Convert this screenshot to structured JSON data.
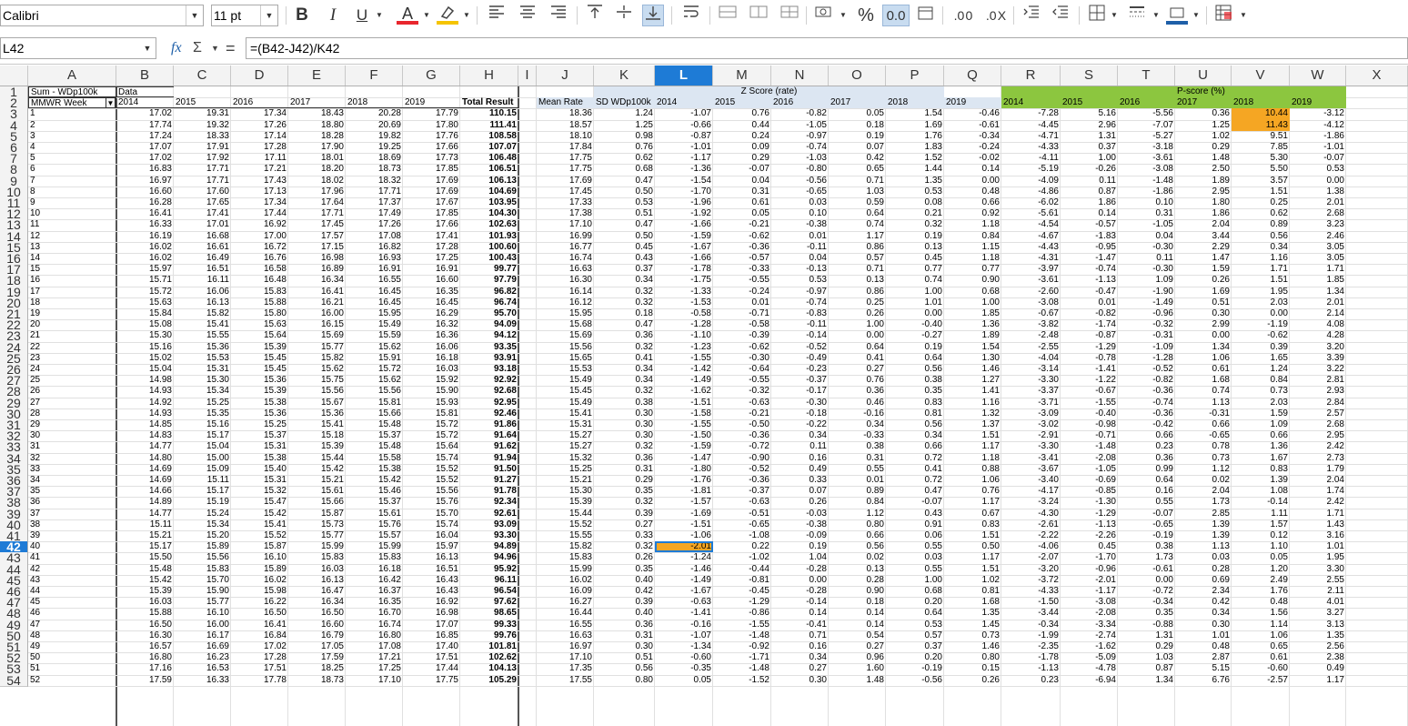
{
  "toolbar": {
    "font_name": "Calibri",
    "font_size": "11 pt",
    "icons": [
      "bold-icon",
      "italic-icon",
      "underline-icon",
      "font-color-icon",
      "highlight-icon",
      "align-left-icon",
      "align-center-icon",
      "align-right-icon",
      "align-top-icon",
      "align-middle-icon",
      "align-bottom-icon",
      "wrap-text-icon",
      "merge-icon",
      "merge-across-icon",
      "unmerge-icon",
      "currency-icon",
      "percent-icon",
      "number-format-icon",
      "date-format-icon",
      "add-decimal-icon",
      "delete-decimal-icon",
      "increase-indent-icon",
      "decrease-indent-icon",
      "borders-icon",
      "border-style-icon",
      "border-color-icon",
      "conditional-format-icon"
    ],
    "glyphs": {
      "bold": "B",
      "italic": "I",
      "underline": "U",
      "font_color": "A",
      "percent": "%",
      "number": "0.0",
      "add_dec": ".0 0",
      "del_dec": ".0 X"
    }
  },
  "formula_bar": {
    "name_box": "L42",
    "fx": "fx",
    "sum": "Σ",
    "equals": "=",
    "formula": "=(B42-J42)/K42"
  },
  "columns": [
    "A",
    "B",
    "C",
    "D",
    "E",
    "F",
    "G",
    "H",
    "I",
    "J",
    "K",
    "L",
    "M",
    "N",
    "O",
    "P",
    "Q",
    "R",
    "S",
    "T",
    "U",
    "V",
    "W",
    "X"
  ],
  "active_column": "L",
  "active_row": 42,
  "headers": {
    "a1": "Sum - WDp100k",
    "b1": "Data",
    "a2": "MMWR Week",
    "years_bg": [
      "2014",
      "2015",
      "2016",
      "2017",
      "2018",
      "2019"
    ],
    "h2": "Total Result",
    "j2": "Mean Rate",
    "k2": "SD WDp100k",
    "z_title": "Z Score (rate)",
    "z_years": [
      "2014",
      "2015",
      "2016",
      "2017",
      "2018",
      "2019"
    ],
    "p_title": "P-score (%)",
    "p_years": [
      "2014",
      "2015",
      "2016",
      "2017",
      "2018",
      "2019"
    ]
  },
  "colors": {
    "active": "#1e7bd6",
    "green": "#8cc63f",
    "zheader": "#dce6f2",
    "highlight": "#f5a623"
  },
  "rows": [
    [
      "1",
      "17.02",
      "19.31",
      "17.34",
      "18.43",
      "20.28",
      "17.79",
      "110.15",
      "18.36",
      "1.24",
      "-1.07",
      "0.76",
      "-0.82",
      "0.05",
      "1.54",
      "-0.46",
      "-7.28",
      "5.16",
      "-5.56",
      "0.36",
      "10.44",
      "-3.12"
    ],
    [
      "2",
      "17.74",
      "19.32",
      "17.26",
      "18.80",
      "20.69",
      "17.80",
      "111.41",
      "18.57",
      "1.25",
      "-0.66",
      "0.44",
      "-1.05",
      "0.18",
      "1.69",
      "-0.61",
      "-4.45",
      "2.96",
      "-7.07",
      "1.25",
      "11.43",
      "-4.12"
    ],
    [
      "3",
      "17.24",
      "18.33",
      "17.14",
      "18.28",
      "19.82",
      "17.76",
      "108.58",
      "18.10",
      "0.98",
      "-0.87",
      "0.24",
      "-0.97",
      "0.19",
      "1.76",
      "-0.34",
      "-4.71",
      "1.31",
      "-5.27",
      "1.02",
      "9.51",
      "-1.86"
    ],
    [
      "4",
      "17.07",
      "17.91",
      "17.28",
      "17.90",
      "19.25",
      "17.66",
      "107.07",
      "17.84",
      "0.76",
      "-1.01",
      "0.09",
      "-0.74",
      "0.07",
      "1.83",
      "-0.24",
      "-4.33",
      "0.37",
      "-3.18",
      "0.29",
      "7.85",
      "-1.01"
    ],
    [
      "5",
      "17.02",
      "17.92",
      "17.11",
      "18.01",
      "18.69",
      "17.73",
      "106.48",
      "17.75",
      "0.62",
      "-1.17",
      "0.29",
      "-1.03",
      "0.42",
      "1.52",
      "-0.02",
      "-4.11",
      "1.00",
      "-3.61",
      "1.48",
      "5.30",
      "-0.07"
    ],
    [
      "6",
      "16.83",
      "17.71",
      "17.21",
      "18.20",
      "18.73",
      "17.85",
      "106.51",
      "17.75",
      "0.68",
      "-1.36",
      "-0.07",
      "-0.80",
      "0.65",
      "1.44",
      "0.14",
      "-5.19",
      "-0.26",
      "-3.08",
      "2.50",
      "5.50",
      "0.53"
    ],
    [
      "7",
      "16.97",
      "17.71",
      "17.43",
      "18.02",
      "18.32",
      "17.69",
      "106.13",
      "17.69",
      "0.47",
      "-1.54",
      "0.04",
      "-0.56",
      "0.71",
      "1.35",
      "0.00",
      "-4.09",
      "0.11",
      "-1.48",
      "1.89",
      "3.57",
      "0.00"
    ],
    [
      "8",
      "16.60",
      "17.60",
      "17.13",
      "17.96",
      "17.71",
      "17.69",
      "104.69",
      "17.45",
      "0.50",
      "-1.70",
      "0.31",
      "-0.65",
      "1.03",
      "0.53",
      "0.48",
      "-4.86",
      "0.87",
      "-1.86",
      "2.95",
      "1.51",
      "1.38"
    ],
    [
      "9",
      "16.28",
      "17.65",
      "17.34",
      "17.64",
      "17.37",
      "17.67",
      "103.95",
      "17.33",
      "0.53",
      "-1.96",
      "0.61",
      "0.03",
      "0.59",
      "0.08",
      "0.66",
      "-6.02",
      "1.86",
      "0.10",
      "1.80",
      "0.25",
      "2.01"
    ],
    [
      "10",
      "16.41",
      "17.41",
      "17.44",
      "17.71",
      "17.49",
      "17.85",
      "104.30",
      "17.38",
      "0.51",
      "-1.92",
      "0.05",
      "0.10",
      "0.64",
      "0.21",
      "0.92",
      "-5.61",
      "0.14",
      "0.31",
      "1.86",
      "0.62",
      "2.68"
    ],
    [
      "11",
      "16.33",
      "17.01",
      "16.92",
      "17.45",
      "17.26",
      "17.66",
      "102.63",
      "17.10",
      "0.47",
      "-1.66",
      "-0.21",
      "-0.38",
      "0.74",
      "0.32",
      "1.18",
      "-4.54",
      "-0.57",
      "-1.05",
      "2.04",
      "0.89",
      "3.23"
    ],
    [
      "12",
      "16.19",
      "16.68",
      "17.00",
      "17.57",
      "17.08",
      "17.41",
      "101.93",
      "16.99",
      "0.50",
      "-1.59",
      "-0.62",
      "0.01",
      "1.17",
      "0.19",
      "0.84",
      "-4.67",
      "-1.83",
      "0.04",
      "3.44",
      "0.56",
      "2.46"
    ],
    [
      "13",
      "16.02",
      "16.61",
      "16.72",
      "17.15",
      "16.82",
      "17.28",
      "100.60",
      "16.77",
      "0.45",
      "-1.67",
      "-0.36",
      "-0.11",
      "0.86",
      "0.13",
      "1.15",
      "-4.43",
      "-0.95",
      "-0.30",
      "2.29",
      "0.34",
      "3.05"
    ],
    [
      "14",
      "16.02",
      "16.49",
      "16.76",
      "16.98",
      "16.93",
      "17.25",
      "100.43",
      "16.74",
      "0.43",
      "-1.66",
      "-0.57",
      "0.04",
      "0.57",
      "0.45",
      "1.18",
      "-4.31",
      "-1.47",
      "0.11",
      "1.47",
      "1.16",
      "3.05"
    ],
    [
      "15",
      "15.97",
      "16.51",
      "16.58",
      "16.89",
      "16.91",
      "16.91",
      "99.77",
      "16.63",
      "0.37",
      "-1.78",
      "-0.33",
      "-0.13",
      "0.71",
      "0.77",
      "0.77",
      "-3.97",
      "-0.74",
      "-0.30",
      "1.59",
      "1.71",
      "1.71"
    ],
    [
      "16",
      "15.71",
      "16.11",
      "16.48",
      "16.34",
      "16.55",
      "16.60",
      "97.79",
      "16.30",
      "0.34",
      "-1.75",
      "-0.55",
      "0.53",
      "0.13",
      "0.74",
      "0.90",
      "-3.61",
      "-1.13",
      "1.09",
      "0.26",
      "1.51",
      "1.85"
    ],
    [
      "17",
      "15.72",
      "16.06",
      "15.83",
      "16.41",
      "16.45",
      "16.35",
      "96.82",
      "16.14",
      "0.32",
      "-1.33",
      "-0.24",
      "-0.97",
      "0.86",
      "1.00",
      "0.68",
      "-2.60",
      "-0.47",
      "-1.90",
      "1.69",
      "1.95",
      "1.34"
    ],
    [
      "18",
      "15.63",
      "16.13",
      "15.88",
      "16.21",
      "16.45",
      "16.45",
      "96.74",
      "16.12",
      "0.32",
      "-1.53",
      "0.01",
      "-0.74",
      "0.25",
      "1.01",
      "1.00",
      "-3.08",
      "0.01",
      "-1.49",
      "0.51",
      "2.03",
      "2.01"
    ],
    [
      "19",
      "15.84",
      "15.82",
      "15.80",
      "16.00",
      "15.95",
      "16.29",
      "95.70",
      "15.95",
      "0.18",
      "-0.58",
      "-0.71",
      "-0.83",
      "0.26",
      "0.00",
      "1.85",
      "-0.67",
      "-0.82",
      "-0.96",
      "0.30",
      "0.00",
      "2.14"
    ],
    [
      "20",
      "15.08",
      "15.41",
      "15.63",
      "16.15",
      "15.49",
      "16.32",
      "94.09",
      "15.68",
      "0.47",
      "-1.28",
      "-0.58",
      "-0.11",
      "1.00",
      "-0.40",
      "1.36",
      "-3.82",
      "-1.74",
      "-0.32",
      "2.99",
      "-1.19",
      "4.08"
    ],
    [
      "21",
      "15.30",
      "15.55",
      "15.64",
      "15.69",
      "15.59",
      "16.36",
      "94.12",
      "15.69",
      "0.36",
      "-1.10",
      "-0.39",
      "-0.14",
      "0.00",
      "-0.27",
      "1.89",
      "-2.48",
      "-0.87",
      "-0.31",
      "0.00",
      "-0.62",
      "4.28"
    ],
    [
      "22",
      "15.16",
      "15.36",
      "15.39",
      "15.77",
      "15.62",
      "16.06",
      "93.35",
      "15.56",
      "0.32",
      "-1.23",
      "-0.62",
      "-0.52",
      "0.64",
      "0.19",
      "1.54",
      "-2.55",
      "-1.29",
      "-1.09",
      "1.34",
      "0.39",
      "3.20"
    ],
    [
      "23",
      "15.02",
      "15.53",
      "15.45",
      "15.82",
      "15.91",
      "16.18",
      "93.91",
      "15.65",
      "0.41",
      "-1.55",
      "-0.30",
      "-0.49",
      "0.41",
      "0.64",
      "1.30",
      "-4.04",
      "-0.78",
      "-1.28",
      "1.06",
      "1.65",
      "3.39"
    ],
    [
      "24",
      "15.04",
      "15.31",
      "15.45",
      "15.62",
      "15.72",
      "16.03",
      "93.18",
      "15.53",
      "0.34",
      "-1.42",
      "-0.64",
      "-0.23",
      "0.27",
      "0.56",
      "1.46",
      "-3.14",
      "-1.41",
      "-0.52",
      "0.61",
      "1.24",
      "3.22"
    ],
    [
      "25",
      "14.98",
      "15.30",
      "15.36",
      "15.75",
      "15.62",
      "15.92",
      "92.92",
      "15.49",
      "0.34",
      "-1.49",
      "-0.55",
      "-0.37",
      "0.76",
      "0.38",
      "1.27",
      "-3.30",
      "-1.22",
      "-0.82",
      "1.68",
      "0.84",
      "2.81"
    ],
    [
      "26",
      "14.93",
      "15.34",
      "15.39",
      "15.56",
      "15.56",
      "15.90",
      "92.68",
      "15.45",
      "0.32",
      "-1.62",
      "-0.32",
      "-0.17",
      "0.36",
      "0.35",
      "1.41",
      "-3.37",
      "-0.67",
      "-0.36",
      "0.74",
      "0.73",
      "2.93"
    ],
    [
      "27",
      "14.92",
      "15.25",
      "15.38",
      "15.67",
      "15.81",
      "15.93",
      "92.95",
      "15.49",
      "0.38",
      "-1.51",
      "-0.63",
      "-0.30",
      "0.46",
      "0.83",
      "1.16",
      "-3.71",
      "-1.55",
      "-0.74",
      "1.13",
      "2.03",
      "2.84"
    ],
    [
      "28",
      "14.93",
      "15.35",
      "15.36",
      "15.36",
      "15.66",
      "15.81",
      "92.46",
      "15.41",
      "0.30",
      "-1.58",
      "-0.21",
      "-0.18",
      "-0.16",
      "0.81",
      "1.32",
      "-3.09",
      "-0.40",
      "-0.36",
      "-0.31",
      "1.59",
      "2.57"
    ],
    [
      "29",
      "14.85",
      "15.16",
      "15.25",
      "15.41",
      "15.48",
      "15.72",
      "91.86",
      "15.31",
      "0.30",
      "-1.55",
      "-0.50",
      "-0.22",
      "0.34",
      "0.56",
      "1.37",
      "-3.02",
      "-0.98",
      "-0.42",
      "0.66",
      "1.09",
      "2.68"
    ],
    [
      "30",
      "14.83",
      "15.17",
      "15.37",
      "15.18",
      "15.37",
      "15.72",
      "91.64",
      "15.27",
      "0.30",
      "-1.50",
      "-0.36",
      "0.34",
      "-0.33",
      "0.34",
      "1.51",
      "-2.91",
      "-0.71",
      "0.66",
      "-0.65",
      "0.66",
      "2.95"
    ],
    [
      "31",
      "14.77",
      "15.04",
      "15.31",
      "15.39",
      "15.48",
      "15.64",
      "91.62",
      "15.27",
      "0.32",
      "-1.59",
      "-0.72",
      "0.11",
      "0.38",
      "0.66",
      "1.17",
      "-3.30",
      "-1.48",
      "0.23",
      "0.78",
      "1.36",
      "2.42"
    ],
    [
      "32",
      "14.80",
      "15.00",
      "15.38",
      "15.44",
      "15.58",
      "15.74",
      "91.94",
      "15.32",
      "0.36",
      "-1.47",
      "-0.90",
      "0.16",
      "0.31",
      "0.72",
      "1.18",
      "-3.41",
      "-2.08",
      "0.36",
      "0.73",
      "1.67",
      "2.73"
    ],
    [
      "33",
      "14.69",
      "15.09",
      "15.40",
      "15.42",
      "15.38",
      "15.52",
      "91.50",
      "15.25",
      "0.31",
      "-1.80",
      "-0.52",
      "0.49",
      "0.55",
      "0.41",
      "0.88",
      "-3.67",
      "-1.05",
      "0.99",
      "1.12",
      "0.83",
      "1.79"
    ],
    [
      "34",
      "14.69",
      "15.11",
      "15.31",
      "15.21",
      "15.42",
      "15.52",
      "91.27",
      "15.21",
      "0.29",
      "-1.76",
      "-0.36",
      "0.33",
      "0.01",
      "0.72",
      "1.06",
      "-3.40",
      "-0.69",
      "0.64",
      "0.02",
      "1.39",
      "2.04"
    ],
    [
      "35",
      "14.66",
      "15.17",
      "15.32",
      "15.61",
      "15.46",
      "15.56",
      "91.78",
      "15.30",
      "0.35",
      "-1.81",
      "-0.37",
      "0.07",
      "0.89",
      "0.47",
      "0.76",
      "-4.17",
      "-0.85",
      "0.16",
      "2.04",
      "1.08",
      "1.74"
    ],
    [
      "36",
      "14.89",
      "15.19",
      "15.47",
      "15.66",
      "15.37",
      "15.76",
      "92.34",
      "15.39",
      "0.32",
      "-1.57",
      "-0.63",
      "0.26",
      "0.84",
      "-0.07",
      "1.17",
      "-3.24",
      "-1.30",
      "0.55",
      "1.73",
      "-0.14",
      "2.42"
    ],
    [
      "37",
      "14.77",
      "15.24",
      "15.42",
      "15.87",
      "15.61",
      "15.70",
      "92.61",
      "15.44",
      "0.39",
      "-1.69",
      "-0.51",
      "-0.03",
      "1.12",
      "0.43",
      "0.67",
      "-4.30",
      "-1.29",
      "-0.07",
      "2.85",
      "1.11",
      "1.71"
    ],
    [
      "38",
      "15.11",
      "15.34",
      "15.41",
      "15.73",
      "15.76",
      "15.74",
      "93.09",
      "15.52",
      "0.27",
      "-1.51",
      "-0.65",
      "-0.38",
      "0.80",
      "0.91",
      "0.83",
      "-2.61",
      "-1.13",
      "-0.65",
      "1.39",
      "1.57",
      "1.43"
    ],
    [
      "39",
      "15.21",
      "15.20",
      "15.52",
      "15.77",
      "15.57",
      "16.04",
      "93.30",
      "15.55",
      "0.33",
      "-1.06",
      "-1.08",
      "-0.09",
      "0.66",
      "0.06",
      "1.51",
      "-2.22",
      "-2.26",
      "-0.19",
      "1.39",
      "0.12",
      "3.16"
    ],
    [
      "40",
      "15.17",
      "15.89",
      "15.87",
      "15.99",
      "15.99",
      "15.97",
      "94.89",
      "15.82",
      "0.32",
      "-2.01",
      "0.22",
      "0.19",
      "0.56",
      "0.55",
      "0.50",
      "-4.06",
      "0.45",
      "0.38",
      "1.13",
      "1.10",
      "1.01"
    ],
    [
      "41",
      "15.50",
      "15.56",
      "16.10",
      "15.83",
      "15.83",
      "16.13",
      "94.96",
      "15.83",
      "0.26",
      "-1.24",
      "-1.02",
      "1.04",
      "0.02",
      "0.03",
      "1.17",
      "-2.07",
      "-1.70",
      "1.73",
      "0.03",
      "0.05",
      "1.95"
    ],
    [
      "42",
      "15.48",
      "15.83",
      "15.89",
      "16.03",
      "16.18",
      "16.51",
      "95.92",
      "15.99",
      "0.35",
      "-1.46",
      "-0.44",
      "-0.28",
      "0.13",
      "0.55",
      "1.51",
      "-3.20",
      "-0.96",
      "-0.61",
      "0.28",
      "1.20",
      "3.30"
    ],
    [
      "43",
      "15.42",
      "15.70",
      "16.02",
      "16.13",
      "16.42",
      "16.43",
      "96.11",
      "16.02",
      "0.40",
      "-1.49",
      "-0.81",
      "0.00",
      "0.28",
      "1.00",
      "1.02",
      "-3.72",
      "-2.01",
      "0.00",
      "0.69",
      "2.49",
      "2.55"
    ],
    [
      "44",
      "15.39",
      "15.90",
      "15.98",
      "16.47",
      "16.37",
      "16.43",
      "96.54",
      "16.09",
      "0.42",
      "-1.67",
      "-0.45",
      "-0.28",
      "0.90",
      "0.68",
      "0.81",
      "-4.33",
      "-1.17",
      "-0.72",
      "2.34",
      "1.76",
      "2.11"
    ],
    [
      "45",
      "16.03",
      "15.77",
      "16.22",
      "16.34",
      "16.35",
      "16.92",
      "97.62",
      "16.27",
      "0.39",
      "-0.63",
      "-1.29",
      "-0.14",
      "0.18",
      "0.20",
      "1.68",
      "-1.50",
      "-3.08",
      "-0.34",
      "0.42",
      "0.48",
      "4.01"
    ],
    [
      "46",
      "15.88",
      "16.10",
      "16.50",
      "16.50",
      "16.70",
      "16.98",
      "98.65",
      "16.44",
      "0.40",
      "-1.41",
      "-0.86",
      "0.14",
      "0.14",
      "0.64",
      "1.35",
      "-3.44",
      "-2.08",
      "0.35",
      "0.34",
      "1.56",
      "3.27"
    ],
    [
      "47",
      "16.50",
      "16.00",
      "16.41",
      "16.60",
      "16.74",
      "17.07",
      "99.33",
      "16.55",
      "0.36",
      "-0.16",
      "-1.55",
      "-0.41",
      "0.14",
      "0.53",
      "1.45",
      "-0.34",
      "-3.34",
      "-0.88",
      "0.30",
      "1.14",
      "3.13"
    ],
    [
      "48",
      "16.30",
      "16.17",
      "16.84",
      "16.79",
      "16.80",
      "16.85",
      "99.76",
      "16.63",
      "0.31",
      "-1.07",
      "-1.48",
      "0.71",
      "0.54",
      "0.57",
      "0.73",
      "-1.99",
      "-2.74",
      "1.31",
      "1.01",
      "1.06",
      "1.35"
    ],
    [
      "49",
      "16.57",
      "16.69",
      "17.02",
      "17.05",
      "17.08",
      "17.40",
      "101.81",
      "16.97",
      "0.30",
      "-1.34",
      "-0.92",
      "0.16",
      "0.27",
      "0.37",
      "1.46",
      "-2.35",
      "-1.62",
      "0.29",
      "0.48",
      "0.65",
      "2.56"
    ],
    [
      "50",
      "16.80",
      "16.23",
      "17.28",
      "17.59",
      "17.21",
      "17.51",
      "102.62",
      "17.10",
      "0.51",
      "-0.60",
      "-1.71",
      "0.34",
      "0.96",
      "0.20",
      "0.80",
      "-1.78",
      "-5.09",
      "1.03",
      "2.87",
      "0.61",
      "2.38"
    ],
    [
      "51",
      "17.16",
      "16.53",
      "17.51",
      "18.25",
      "17.25",
      "17.44",
      "104.13",
      "17.35",
      "0.56",
      "-0.35",
      "-1.48",
      "0.27",
      "1.60",
      "-0.19",
      "0.15",
      "-1.13",
      "-4.78",
      "0.87",
      "5.15",
      "-0.60",
      "0.49"
    ],
    [
      "52",
      "17.59",
      "16.33",
      "17.78",
      "18.73",
      "17.10",
      "17.75",
      "105.29",
      "17.55",
      "0.80",
      "0.05",
      "-1.52",
      "0.30",
      "1.48",
      "-0.56",
      "0.26",
      "0.23",
      "-6.94",
      "1.34",
      "6.76",
      "-2.57",
      "1.17"
    ]
  ]
}
